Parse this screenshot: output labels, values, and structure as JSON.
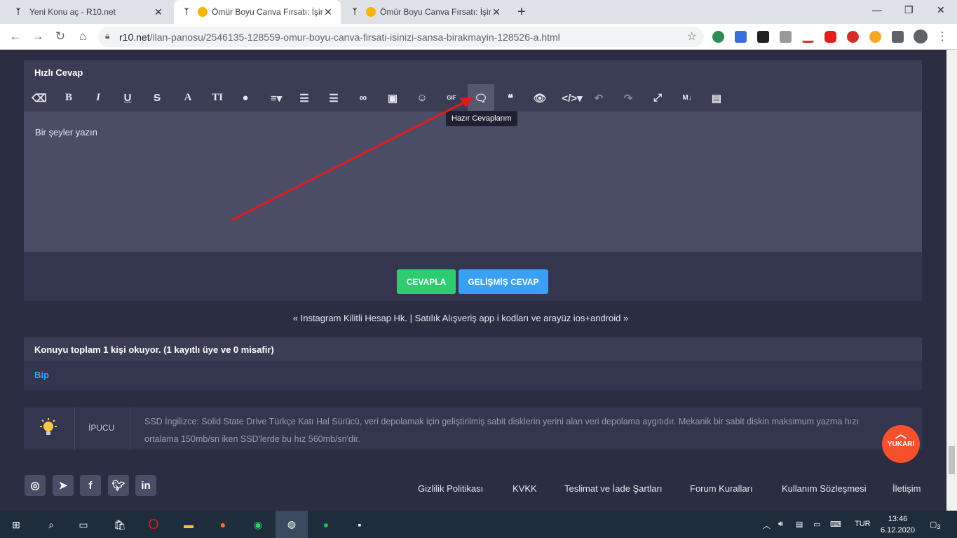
{
  "browser": {
    "tabs": [
      {
        "title": "Yeni Konu aç - R10.net"
      },
      {
        "title": "Ömür Boyu Canva Fırsatı: İşin"
      },
      {
        "title": "Ömür Boyu Canva Fırsatı: İşin"
      }
    ],
    "new_tab": "+",
    "url_host": "r10.net",
    "url_path": "/ilan-panosu/2546135-128559-omur-boyu-canva-firsati-isinizi-sansa-birakmayin-128526-a.html"
  },
  "panel": {
    "title": "Hızlı Cevap",
    "editor_placeholder": "Bir şeyler yazın",
    "tooltip": "Hazır Cevaplarım",
    "toolbar": [
      "eraser-icon",
      "bold",
      "italic",
      "underline",
      "strikethrough",
      "font-size",
      "text-height",
      "palette",
      "align",
      "bullet-list",
      "numbered-list",
      "link",
      "image",
      "emoji",
      "gif",
      "saved-replies",
      "quote",
      "spoiler",
      "code",
      "undo",
      "redo",
      "fullscreen",
      "markdown",
      "preview"
    ],
    "toolbar_glyphs": {
      "bold": "B",
      "italic": "I",
      "underline": "U",
      "strike": "S",
      "font": "A",
      "theight": "TI",
      "gif": "GIF",
      "quote": "❝",
      "md": "M↓"
    },
    "reply_button": "CEVAPLA",
    "advanced_button": "GELİŞMİŞ CEVAP"
  },
  "prev_next": "« Instagram Kilitli Hesap Hk. | Satılık Alışveriş app i kodları ve arayüz ios+android »",
  "readers": {
    "title": "Konuyu toplam 1 kişi okuyor. (1 kayıtlı üye ve 0 misafir)",
    "user": "Bip"
  },
  "tip": {
    "label": "İPUCU",
    "text": "SSD İngilizce: Solid State Drive Türkçe Katı Hal Sürücü, veri depolamak için geliştirilmiş sabit disklerin yerini alan veri depolama aygıtıdır. Mekanik bir sabit diskin maksimum yazma hızı ortalama 150mb/sn iken SSD'lerde bu hız 560mb/sn'dir."
  },
  "up_button": "YUKARI",
  "footer": {
    "links": [
      "Gizlilik Politikası",
      "KVKK",
      "Teslimat ve İade Şartları",
      "Forum Kuralları",
      "Kullanım Sözleşmesi",
      "İletişim"
    ],
    "social": [
      "instagram-icon",
      "telegram-icon",
      "facebook-icon",
      "twitter-icon",
      "linkedin-icon"
    ],
    "social_glyphs": {
      "facebook": "f",
      "linkedin": "in"
    }
  },
  "taskbar": {
    "lang": "TUR",
    "time": "13:46",
    "date": "6.12.2020",
    "notifications": "3"
  },
  "colors": {
    "accent_green": "#2ecc71",
    "accent_blue": "#3aa0f5",
    "up_orange": "#f4512c",
    "annotation_arrow": "#e01b1b"
  }
}
